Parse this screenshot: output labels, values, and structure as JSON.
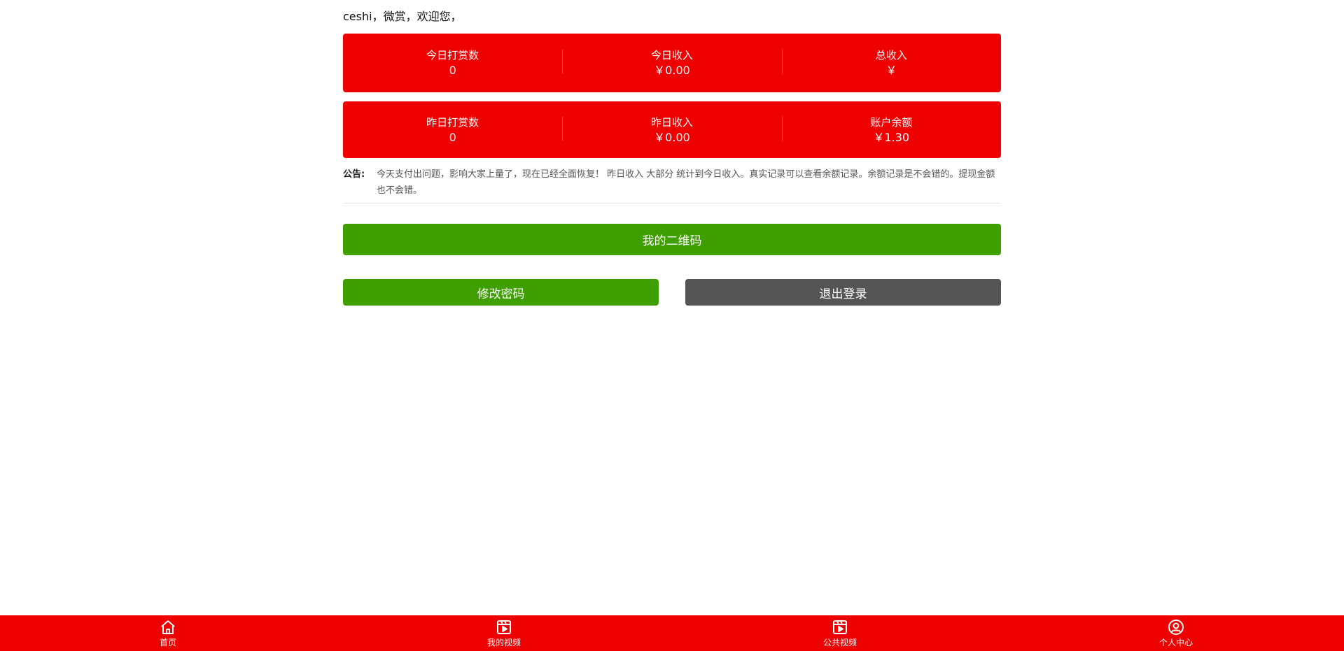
{
  "greeting": "ceshi，微赏，欢迎您，",
  "today_stats": [
    {
      "label": "今日打赏数",
      "value": "0"
    },
    {
      "label": "今日收入",
      "value": "￥0.00"
    },
    {
      "label": "总收入",
      "value": "￥"
    }
  ],
  "yesterday_stats": [
    {
      "label": "昨日打赏数",
      "value": "0"
    },
    {
      "label": "昨日收入",
      "value": "￥0.00"
    },
    {
      "label": "账户余额",
      "value": "￥1.30"
    }
  ],
  "notice": {
    "label": "公告:",
    "text": "今天支付出问题，影响大家上量了，现在已经全面恢复！ 昨日收入 大部分 统计到今日收入。真实记录可以查看余额记录。余额记录是不会错的。提现金额也不会错。"
  },
  "buttons": {
    "qr": "我的二维码",
    "password": "修改密码",
    "logout": "退出登录"
  },
  "tabbar": [
    {
      "label": "首页",
      "icon": "home-icon"
    },
    {
      "label": "我的视频",
      "icon": "video-icon"
    },
    {
      "label": "公共视频",
      "icon": "video-icon"
    },
    {
      "label": "个人中心",
      "icon": "user-icon"
    }
  ],
  "colors": {
    "primary_red": "#ee0000",
    "green": "#3f9e00",
    "gray": "#555555"
  }
}
